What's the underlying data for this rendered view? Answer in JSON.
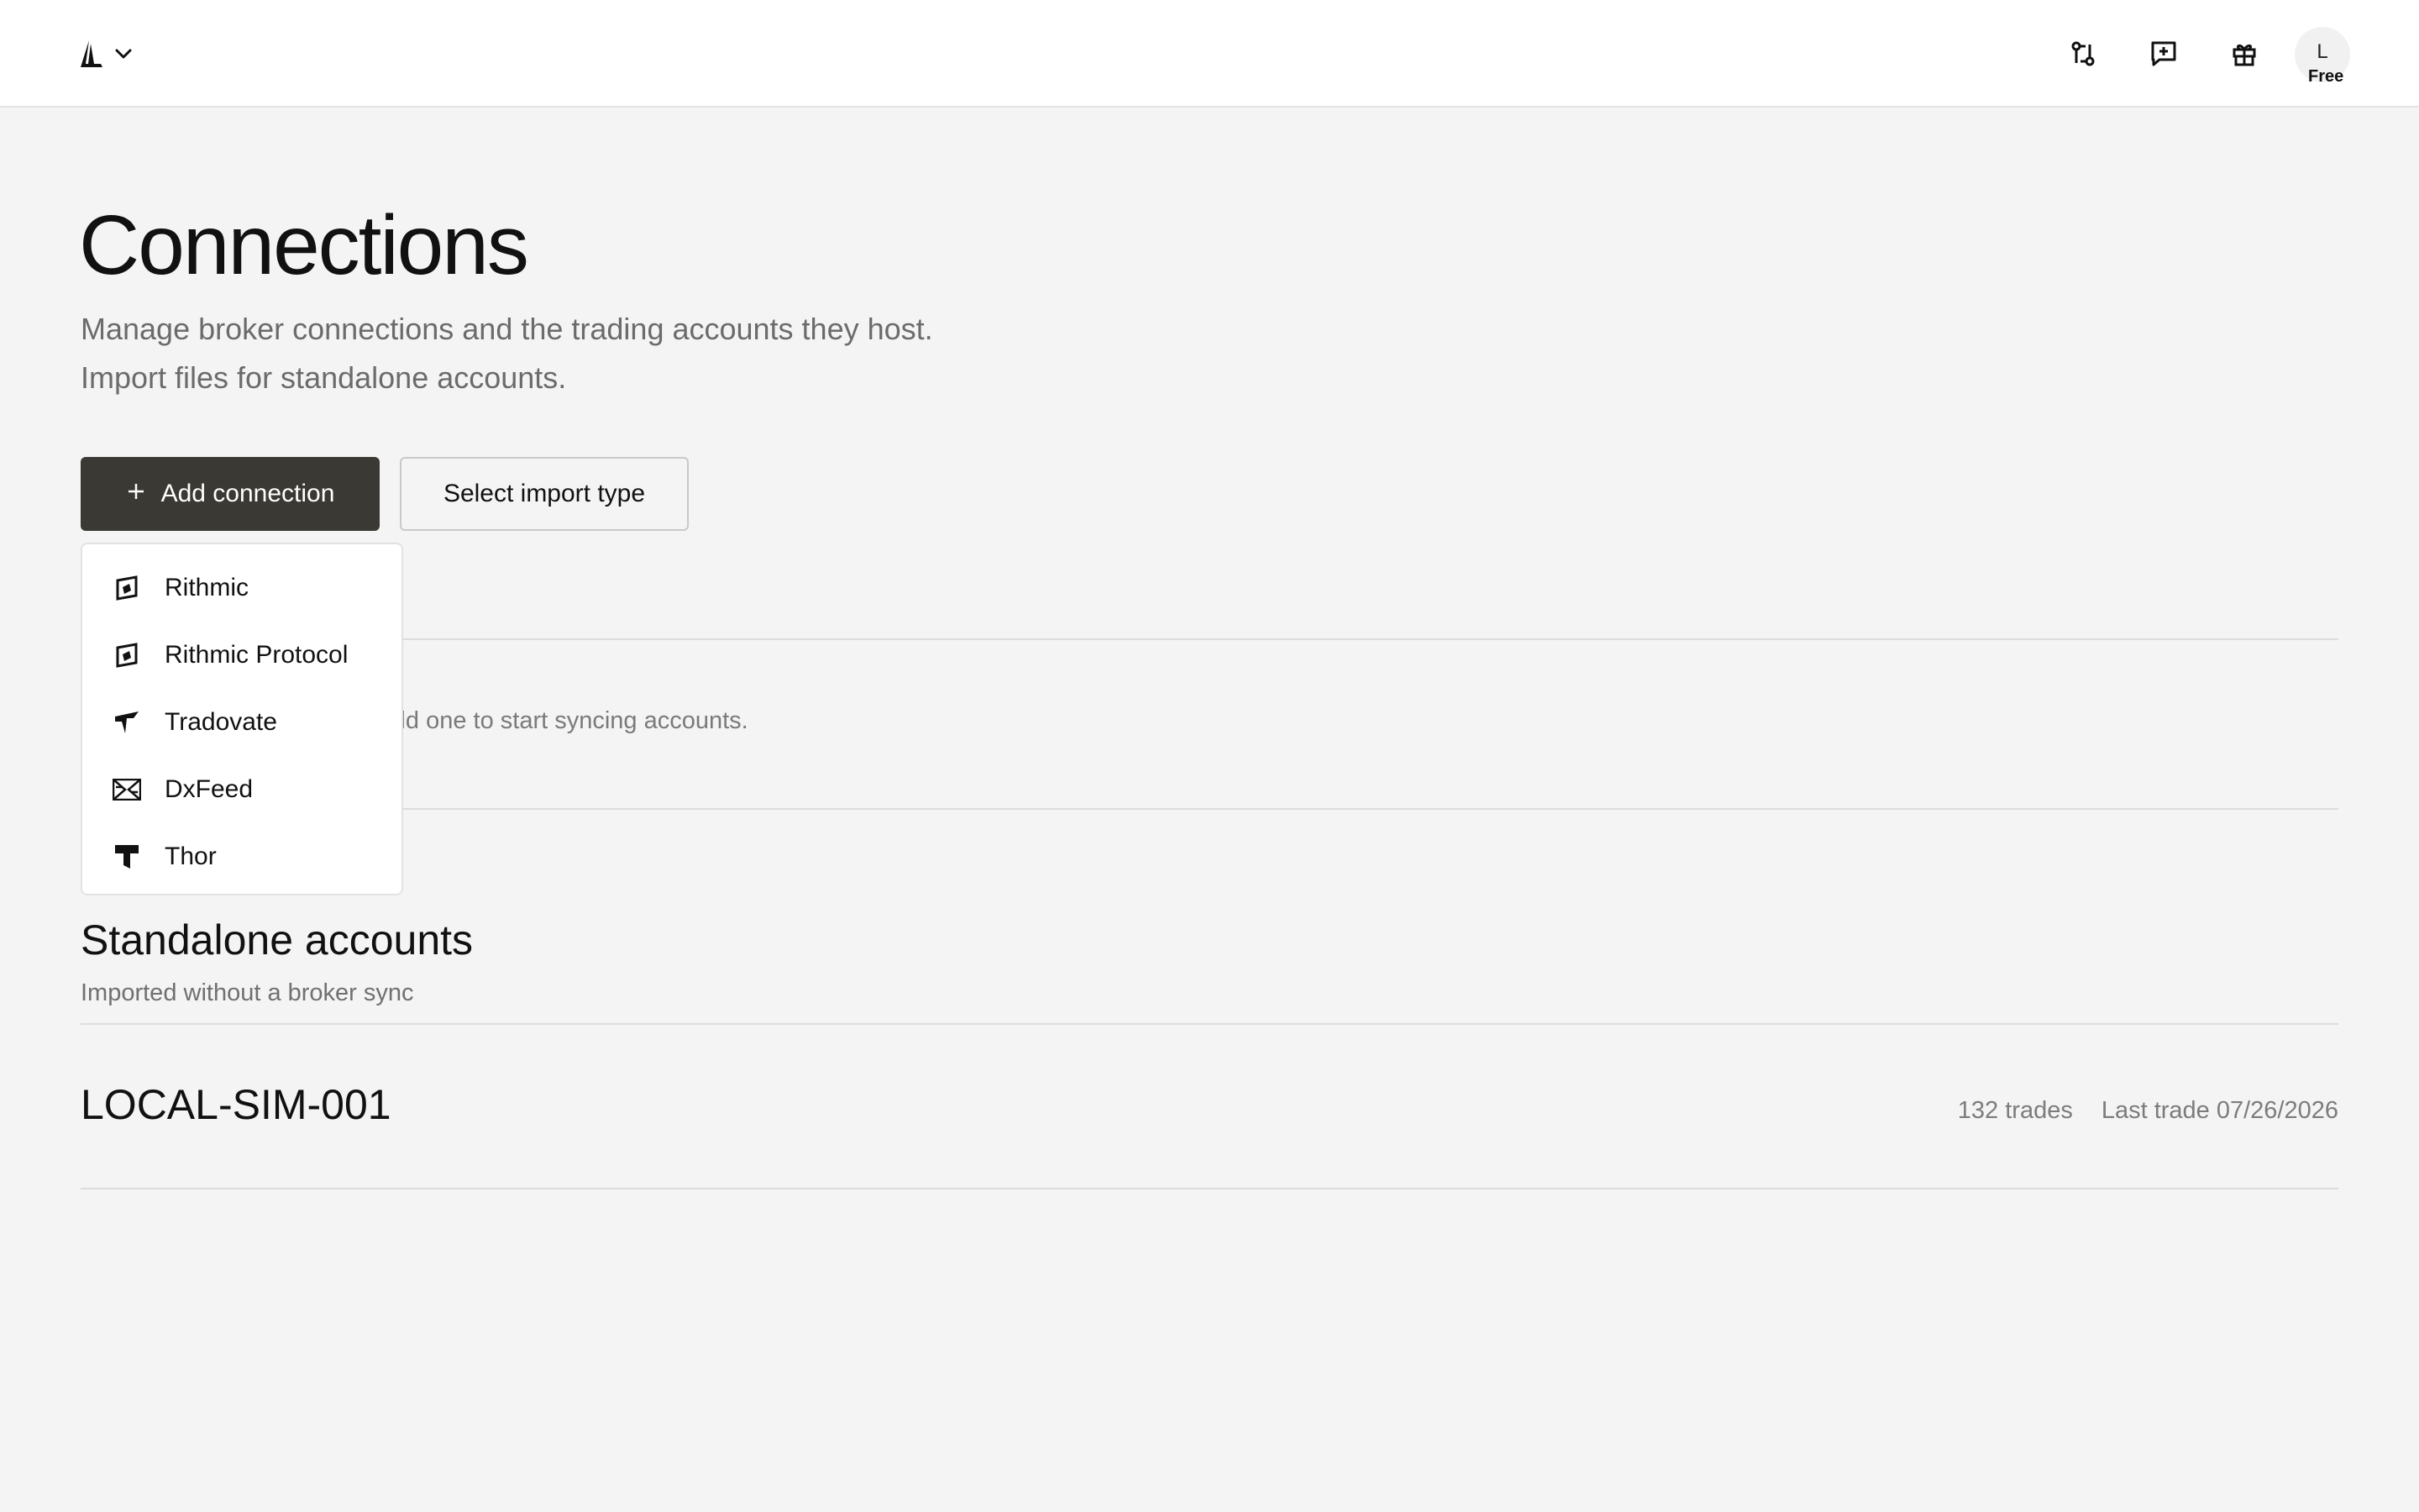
{
  "header": {
    "logo_icon": "brand-sail-logo",
    "workspace_menu_icon": "chevron-down-icon",
    "icons": [
      "broker-sync-icon",
      "feedback-message-icon",
      "gift-icon"
    ],
    "avatar_initial": "L",
    "plan_badge": "Free"
  },
  "page": {
    "title": "Connections",
    "subtitle_line1": "Manage broker connections and the trading accounts they host.",
    "subtitle_line2": "Import files for standalone accounts."
  },
  "actions": {
    "add_connection_label": "Add connection",
    "select_import_label": "Select import type"
  },
  "connections": {
    "empty_text_visible": "dd one to start syncing accounts."
  },
  "dropdown": {
    "items": [
      {
        "label": "Rithmic",
        "icon": "rithmic-icon"
      },
      {
        "label": "Rithmic Protocol",
        "icon": "rithmic-protocol-icon"
      },
      {
        "label": "Tradovate",
        "icon": "tradovate-icon"
      },
      {
        "label": "DxFeed",
        "icon": "dxfeed-icon"
      },
      {
        "label": "Thor",
        "icon": "thor-icon"
      }
    ]
  },
  "standalone": {
    "title": "Standalone accounts",
    "subtitle": "Imported without a broker sync",
    "accounts": [
      {
        "name": "LOCAL-SIM-001",
        "trades": "132 trades",
        "last_trade": "Last trade 07/26/2026"
      }
    ]
  }
}
